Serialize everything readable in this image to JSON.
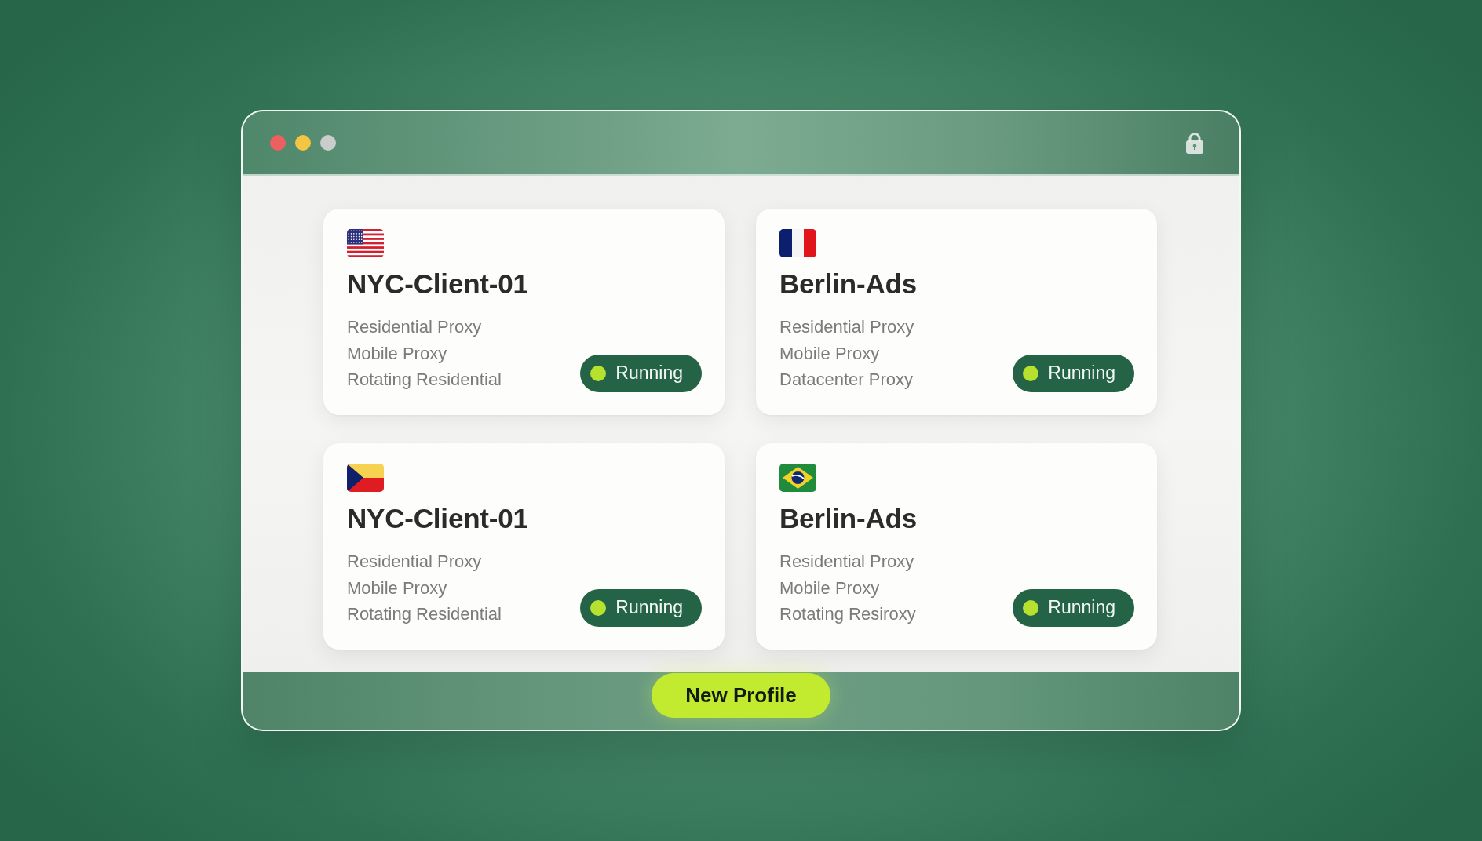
{
  "profiles": [
    {
      "name": "NYC-Client-01",
      "proxies": [
        "Residential Proxy",
        "Mobile Proxy",
        "Rotating Residential"
      ],
      "status": "Running"
    },
    {
      "name": "Berlin-Ads",
      "proxies": [
        "Residential Proxy",
        "Mobile Proxy",
        "Datacenter Proxy"
      ],
      "status": "Running"
    },
    {
      "name": "NYC-Client-01",
      "proxies": [
        "Residential Proxy",
        "Mobile Proxy",
        "Rotating Residential"
      ],
      "status": "Running"
    },
    {
      "name": "Berlin-Ads",
      "proxies": [
        "Residential Proxy",
        "Mobile Proxy",
        "Rotating Resiroxy"
      ],
      "status": "Running"
    }
  ],
  "footer": {
    "button": "New Profile"
  }
}
